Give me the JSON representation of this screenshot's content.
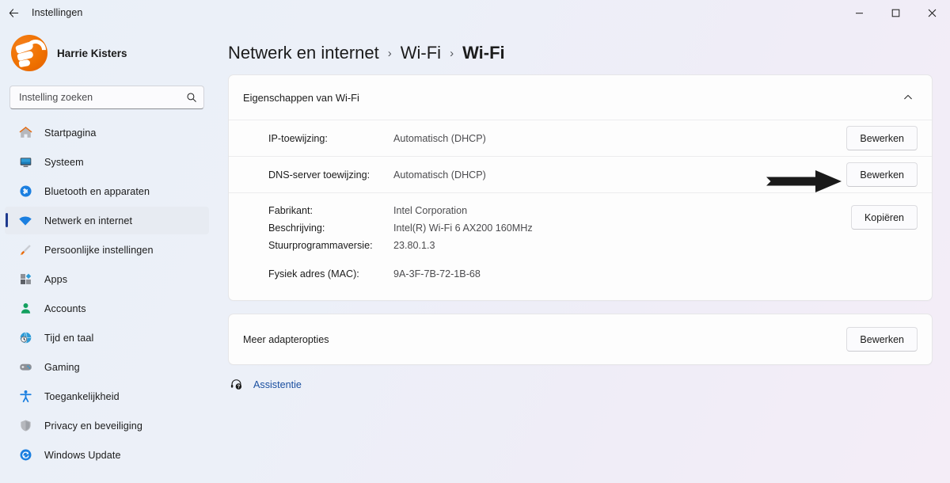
{
  "window": {
    "title": "Instellingen",
    "back_icon": "back-arrow-icon",
    "minimize_label": "–",
    "maximize_label": "□",
    "close_label": "×"
  },
  "sidebar": {
    "user_name": "Harrie Kisters",
    "search": {
      "placeholder": "Instelling zoeken",
      "value": "",
      "icon": "search-icon"
    },
    "items": [
      {
        "label": "Startpagina",
        "icon": "home-icon",
        "selected": false
      },
      {
        "label": "Systeem",
        "icon": "monitor-icon",
        "selected": false
      },
      {
        "label": "Bluetooth en apparaten",
        "icon": "bluetooth-icon",
        "selected": false
      },
      {
        "label": "Netwerk en internet",
        "icon": "wifi-icon",
        "selected": true
      },
      {
        "label": "Persoonlijke instellingen",
        "icon": "paintbrush-icon",
        "selected": false
      },
      {
        "label": "Apps",
        "icon": "apps-icon",
        "selected": false
      },
      {
        "label": "Accounts",
        "icon": "person-icon",
        "selected": false
      },
      {
        "label": "Tijd en taal",
        "icon": "clock-globe-icon",
        "selected": false
      },
      {
        "label": "Gaming",
        "icon": "gamepad-icon",
        "selected": false
      },
      {
        "label": "Toegankelijkheid",
        "icon": "accessibility-icon",
        "selected": false
      },
      {
        "label": "Privacy en beveiliging",
        "icon": "shield-icon",
        "selected": false
      },
      {
        "label": "Windows Update",
        "icon": "update-icon",
        "selected": false
      }
    ]
  },
  "breadcrumb": {
    "level1": "Netwerk en internet",
    "sep1": "›",
    "level2": "Wi-Fi",
    "sep2": "›",
    "level3": "Wi-Fi"
  },
  "properties_card": {
    "header": "Eigenschappen van Wi-Fi",
    "collapse_icon": "chevron-up-icon",
    "rows": [
      {
        "label": "IP-toewijzing:",
        "value": "Automatisch (DHCP)",
        "button": "Bewerken"
      },
      {
        "label": "DNS-server toewijzing:",
        "value": "Automatisch (DHCP)",
        "button": "Bewerken"
      }
    ],
    "adapter": {
      "lines": [
        {
          "key": "Fabrikant:",
          "value": "Intel Corporation"
        },
        {
          "key": "Beschrijving:",
          "value": "Intel(R) Wi-Fi 6 AX200 160MHz"
        },
        {
          "key": "Stuurprogrammaversie:",
          "value": "23.80.1.3"
        },
        {
          "key": "Fysiek adres (MAC):",
          "value": "9A-3F-7B-72-1B-68"
        }
      ],
      "copy_button": "Kopiëren"
    }
  },
  "adapter_options_card": {
    "title": "Meer adapteropties",
    "button": "Bewerken"
  },
  "assistance": {
    "label": "Assistentie",
    "icon": "help-headset-icon"
  },
  "annotation": {
    "arrow_target": "dns-edit-button",
    "color": "#1a1a1a"
  },
  "colors": {
    "accent": "#1e3a8f",
    "link": "#1a4fa0",
    "card_bg": "#fdfdfd",
    "selected_bg": "#e7ebf2"
  }
}
